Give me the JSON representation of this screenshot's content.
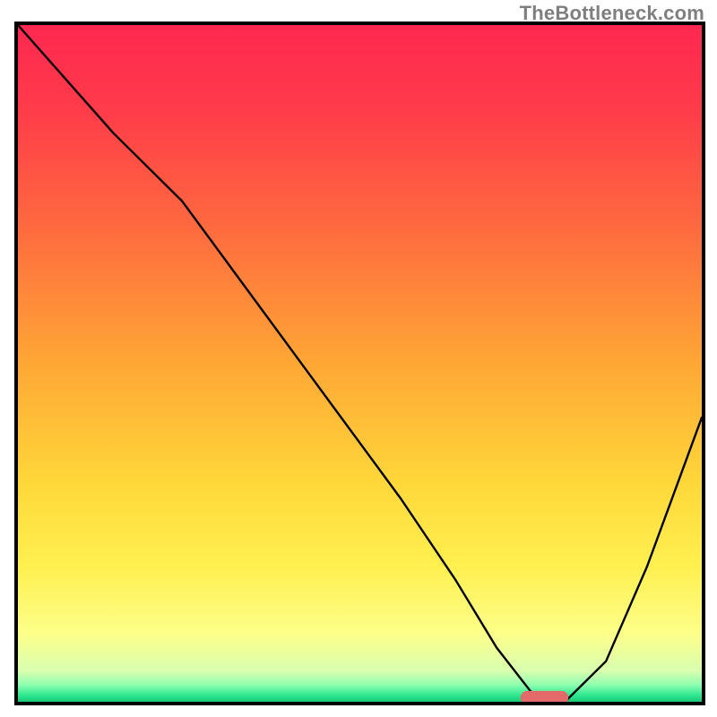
{
  "watermark": "TheBottleneck.com",
  "chart_data": {
    "type": "line",
    "title": "",
    "xlabel": "",
    "ylabel": "",
    "xlim": [
      0,
      100
    ],
    "ylim": [
      0,
      100
    ],
    "grid": false,
    "legend": false,
    "background": {
      "type": "vertical-gradient",
      "stops": [
        {
          "pos": 0.0,
          "color": "#ff2850"
        },
        {
          "pos": 0.12,
          "color": "#ff3a4a"
        },
        {
          "pos": 0.3,
          "color": "#ff6a3f"
        },
        {
          "pos": 0.5,
          "color": "#ffa735"
        },
        {
          "pos": 0.68,
          "color": "#ffd83a"
        },
        {
          "pos": 0.8,
          "color": "#fff050"
        },
        {
          "pos": 0.9,
          "color": "#fdff8a"
        },
        {
          "pos": 0.955,
          "color": "#d8ffb0"
        },
        {
          "pos": 0.975,
          "color": "#8fffb0"
        },
        {
          "pos": 0.99,
          "color": "#30e890"
        },
        {
          "pos": 1.0,
          "color": "#18c878"
        }
      ]
    },
    "series": [
      {
        "name": "bottleneck-curve",
        "color": "#000000",
        "stroke_width": 2.4,
        "x": [
          0,
          14,
          24,
          40,
          56,
          64,
          70,
          75,
          80,
          86,
          92,
          100
        ],
        "y": [
          100,
          84,
          74,
          52,
          30,
          18,
          8,
          1.5,
          0,
          6,
          20,
          42
        ]
      }
    ],
    "marker": {
      "name": "optimal-range",
      "shape": "capsule",
      "color": "#e46a6a",
      "x_center": 77,
      "y_center": 0.6,
      "width_x": 7,
      "height_y": 2.0
    },
    "frame": {
      "color": "#000000",
      "width": 4
    }
  }
}
